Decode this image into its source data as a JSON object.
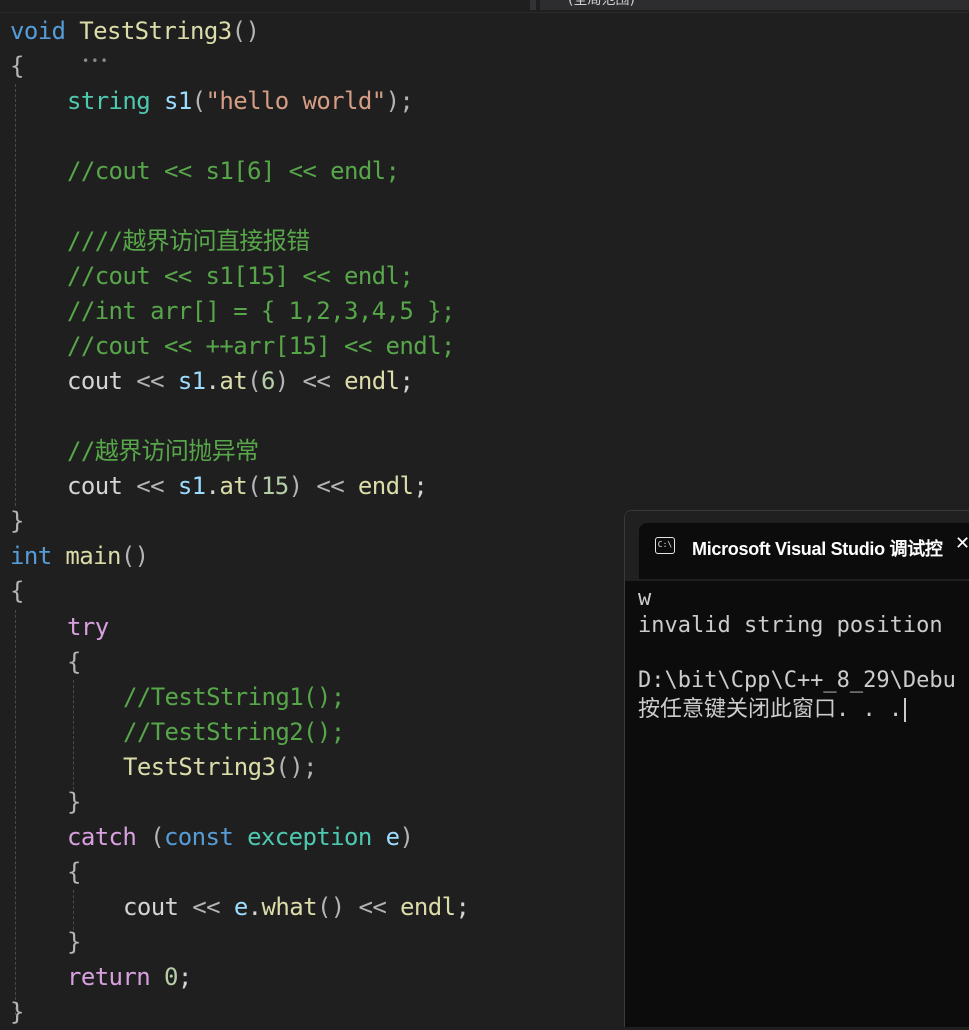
{
  "topbar": {
    "tab_label": "(全局范围)"
  },
  "code": {
    "l1": {
      "kw": "void",
      "fn": "TestString3",
      "paren": "()"
    },
    "l2": {
      "brace": "{"
    },
    "l3": {
      "type": "string",
      "var": "s1",
      "open": "(",
      "str": "\"hello world\"",
      "close": ");"
    },
    "l5": "//cout << s1[6] << endl;",
    "l7": "////越界访问直接报错",
    "l8": "//cout << s1[15] << endl;",
    "l9": "//int arr[] = { 1,2,3,4,5 };",
    "l10": "//cout << ++arr[15] << endl;",
    "l11": {
      "cout": "cout",
      "op1": " << ",
      "var": "s1",
      "dot": ".",
      "fn": "at",
      "open": "(",
      "num": "6",
      "close": ")",
      "op2": " << ",
      "endl": "endl",
      "semi": ";"
    },
    "l13": "//越界访问抛异常",
    "l14": {
      "cout": "cout",
      "op1": " << ",
      "var": "s1",
      "dot": ".",
      "fn": "at",
      "open": "(",
      "num": "15",
      "close": ")",
      "op2": " << ",
      "endl": "endl",
      "semi": ";"
    },
    "l15": {
      "brace": "}"
    },
    "l16": {
      "kw": "int",
      "fn": "main",
      "paren": "()"
    },
    "l17": {
      "brace": "{"
    },
    "l18": {
      "kw": "try"
    },
    "l19": {
      "brace": "{"
    },
    "l20": "//TestString1();",
    "l21": "//TestString2();",
    "l22": {
      "fn": "TestString3",
      "rest": "();"
    },
    "l23": {
      "brace": "}"
    },
    "l24": {
      "kw": "catch",
      "open": " (",
      "kw2": "const",
      "sp": " ",
      "type": "exception",
      "sp2": " ",
      "var": "e",
      "close": ")"
    },
    "l25": {
      "brace": "{"
    },
    "l26": {
      "cout": "cout",
      "op1": " << ",
      "var": "e",
      "dot": ".",
      "fn": "what",
      "paren": "()",
      "op2": " << ",
      "endl": "endl",
      "semi": ";"
    },
    "l27": {
      "brace": "}"
    },
    "l28": {
      "kw": "return",
      "sp": " ",
      "num": "0",
      "semi": ";"
    },
    "l29": {
      "brace": "}"
    }
  },
  "console": {
    "icon": "C:\\",
    "title": "Microsoft Visual Studio 调试控",
    "close": "✕",
    "lines": [
      "w",
      "invalid string position",
      "",
      "D:\\bit\\Cpp\\C++_8_29\\Debu",
      "按任意键关闭此窗口. . ."
    ]
  },
  "colors": {
    "editor_bg": "#1f1f1f",
    "keyword": "#569cd6",
    "control": "#d8a0df",
    "function": "#dcdcaa",
    "type": "#4ec9b0",
    "variable": "#9cdcfe",
    "string": "#d69d85",
    "number": "#b5cea8",
    "comment": "#57a64a",
    "console_bg": "#0c0c0c"
  }
}
